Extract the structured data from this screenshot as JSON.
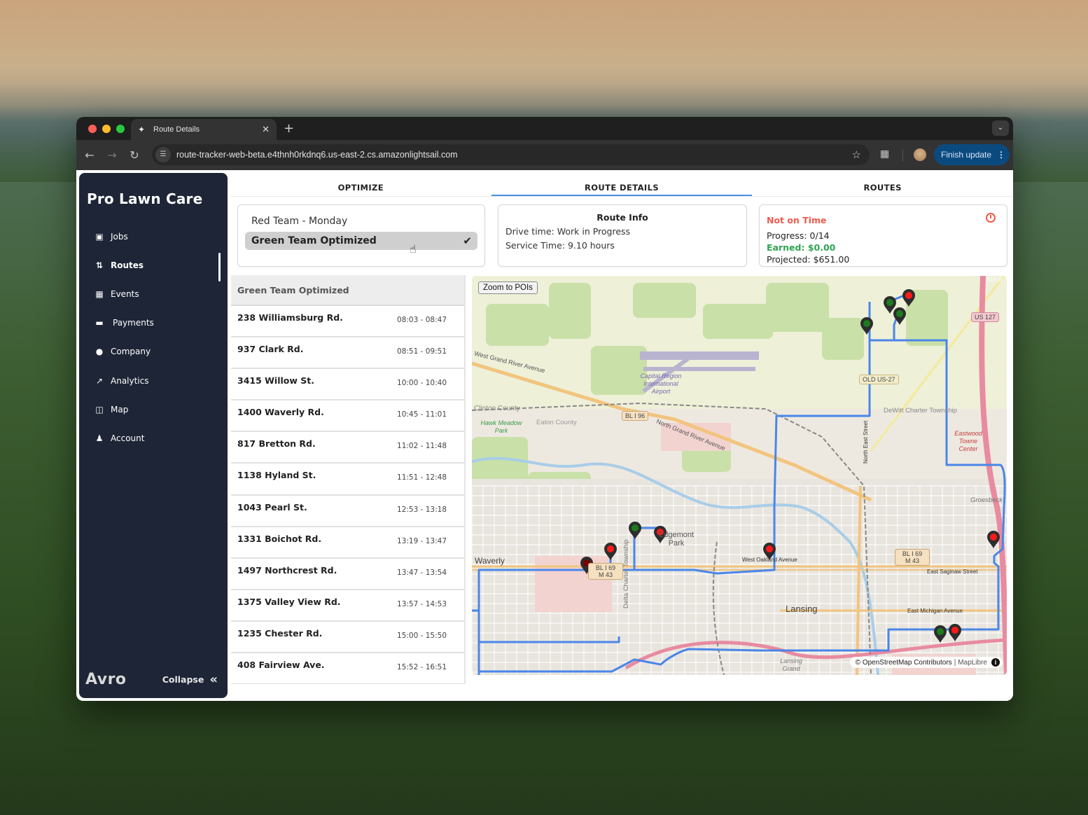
{
  "browser": {
    "tab_title": "Route Details",
    "url": "route-tracker-web-beta.e4thnh0rkdnq6.us-east-2.cs.amazonlightsail.com",
    "finish_update_label": "Finish update"
  },
  "sidebar": {
    "brand": "Pro Lawn Care",
    "items": [
      {
        "label": "Jobs",
        "icon": "briefcase-icon",
        "active": false
      },
      {
        "label": "Routes",
        "icon": "route-icon",
        "active": true
      },
      {
        "label": "Events",
        "icon": "calendar-icon",
        "active": false
      },
      {
        "label": "Payments",
        "icon": "credit-card-icon",
        "active": false
      },
      {
        "label": "Company",
        "icon": "info-circle-icon",
        "active": false
      },
      {
        "label": "Analytics",
        "icon": "chart-line-icon",
        "active": false
      },
      {
        "label": "Map",
        "icon": "map-icon",
        "active": false
      },
      {
        "label": "Account",
        "icon": "user-icon",
        "active": false
      }
    ],
    "footer_logo": "Avro",
    "collapse_label": "Collapse"
  },
  "tabs": [
    {
      "label": "OPTIMIZE",
      "active": false
    },
    {
      "label": "ROUTE DETAILS",
      "active": true
    },
    {
      "label": "ROUTES",
      "active": false
    }
  ],
  "route_select": {
    "options": [
      {
        "label": "Red Team - Monday",
        "selected": false
      },
      {
        "label": "Green Team Optimized",
        "selected": true
      }
    ]
  },
  "route_info": {
    "title": "Route Info",
    "drive_time": "Drive time: Work in Progress",
    "service_time": "Service Time: 9.10 hours"
  },
  "status": {
    "title": "Not on Time",
    "progress": "Progress: 0/14",
    "earned": "Earned: $0.00",
    "projected": "Projected: $651.00",
    "colors": {
      "late": "#ee5b4c",
      "earned": "#2ea44f"
    }
  },
  "stops": {
    "header": "Green Team Optimized",
    "items": [
      {
        "address": "238 Williamsburg Rd.",
        "time": "08:03 - 08:47"
      },
      {
        "address": "937 Clark Rd.",
        "time": "08:51 - 09:51"
      },
      {
        "address": "3415 Willow St.",
        "time": "10:00 - 10:40"
      },
      {
        "address": "1400 Waverly Rd.",
        "time": "10:45 - 11:01"
      },
      {
        "address": "817 Bretton Rd.",
        "time": "11:02 - 11:48"
      },
      {
        "address": "1138 Hyland St.",
        "time": "11:51 - 12:48"
      },
      {
        "address": "1043 Pearl St.",
        "time": "12:53 - 13:18"
      },
      {
        "address": "1331 Boichot Rd.",
        "time": "13:19 - 13:47"
      },
      {
        "address": "1497 Northcrest Rd.",
        "time": "13:47 - 13:54"
      },
      {
        "address": "1375 Valley View Rd.",
        "time": "13:57 - 14:53"
      },
      {
        "address": "1235 Chester Rd.",
        "time": "15:00 - 15:50"
      },
      {
        "address": "408 Fairview Ave.",
        "time": "15:52 - 16:51"
      }
    ]
  },
  "map": {
    "zoom_button": "Zoom to POIs",
    "attribution": "© OpenStreetMap Contributors",
    "attribution_link": "MapLibre",
    "route_color": "#4a86e8",
    "labels": {
      "airport": "Capital Region International Airport",
      "waverly": "Waverly",
      "lansing": "Lansing",
      "edgemont": "Edgemont Park",
      "dewitt": "DeWitt Charter Township",
      "eastwood": "Eastwood Towne Center",
      "groesbeck": "Groesbeck",
      "grand_river_ave": "West Grand River Avenue",
      "n_grand_river_ave": "North Grand River Avenue",
      "clinton": "Clinton County",
      "eaton": "Eaton County",
      "hawk_meadow": "Hawk Meadow Park",
      "e_saginaw": "East Saginaw Street",
      "e_michigan": "East Michigan Avenue",
      "w_oakland": "West Oakland Avenue",
      "delta": "Delta Charter Township",
      "ne_street": "North East Street",
      "lansing_grand": "Lansing Grand"
    },
    "shields": {
      "bl196": "BL I 96",
      "us127": "US 127",
      "old_us27": "OLD US-27",
      "bl169_a": "BL I 69",
      "m43_a": "M 43",
      "bl169_b": "BL I 69",
      "m43_b": "M 43",
      "exit": "82A-B"
    },
    "markers": [
      {
        "status": "complete"
      },
      {
        "status": "complete"
      },
      {
        "status": "late"
      },
      {
        "status": "complete"
      },
      {
        "status": "complete"
      },
      {
        "status": "late"
      },
      {
        "status": "late"
      },
      {
        "status": "missed"
      },
      {
        "status": "late"
      },
      {
        "status": "late"
      },
      {
        "status": "complete"
      },
      {
        "status": "late"
      }
    ],
    "marker_colors": {
      "complete": "#1e7b1e",
      "late": "#ff1a1a",
      "missed": "#7a0000"
    }
  }
}
